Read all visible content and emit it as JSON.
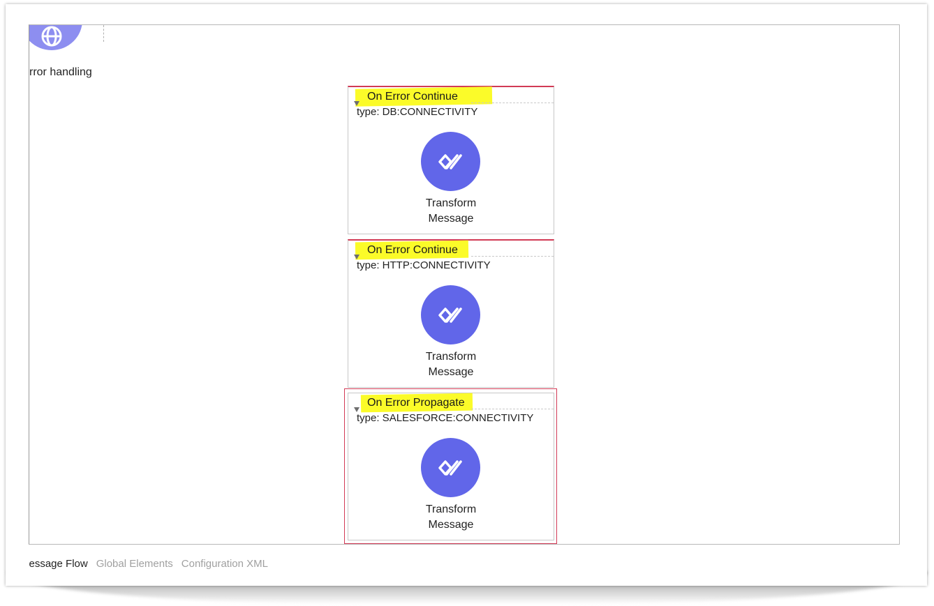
{
  "canvas": {
    "section_label": "rror handling"
  },
  "handlers": [
    {
      "title": "On Error Continue",
      "type": "type: DB:CONNECTIVITY",
      "component": {
        "label_line1": "Transform",
        "label_line2": "Message"
      }
    },
    {
      "title": "On Error Continue",
      "type": "type: HTTP:CONNECTIVITY",
      "component": {
        "label_line1": "Transform",
        "label_line2": "Message"
      }
    },
    {
      "title": "On Error Propagate",
      "type": "type: SALESFORCE:CONNECTIVITY",
      "component": {
        "label_line1": "Transform",
        "label_line2": "Message"
      }
    }
  ],
  "tabs": [
    {
      "label": "Message Flow",
      "active": true
    },
    {
      "label": "Global Elements",
      "active": false
    },
    {
      "label": "Configuration XML",
      "active": false
    }
  ],
  "colors": {
    "component_icon": "#6166e9",
    "highlight": "#fbfb29",
    "error_border": "#d23a55"
  },
  "icons": {
    "top_component": "globe-icon",
    "transform": "dataweave-transform-icon"
  }
}
